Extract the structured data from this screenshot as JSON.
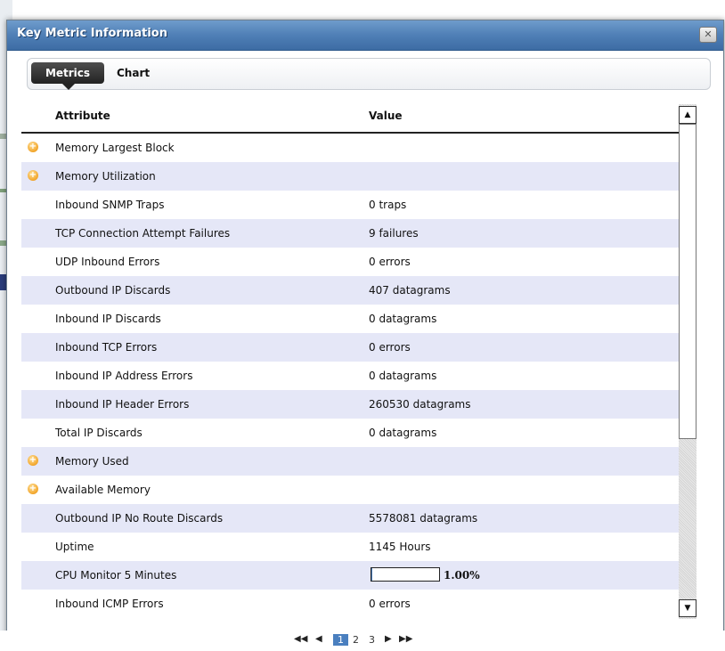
{
  "dialog": {
    "title": "Key Metric Information",
    "close_glyph": "✕"
  },
  "tabs": [
    {
      "label": "Metrics",
      "active": true
    },
    {
      "label": "Chart",
      "active": false
    }
  ],
  "table": {
    "columns": [
      "Attribute",
      "Value"
    ],
    "rows": [
      {
        "attribute": "Memory Largest Block",
        "value": "",
        "expandable": true
      },
      {
        "attribute": "Memory Utilization",
        "value": "",
        "expandable": true
      },
      {
        "attribute": "Inbound SNMP Traps",
        "value": "0 traps",
        "expandable": false
      },
      {
        "attribute": "TCP Connection Attempt Failures",
        "value": "9 failures",
        "expandable": false
      },
      {
        "attribute": "UDP Inbound Errors",
        "value": "0 errors",
        "expandable": false
      },
      {
        "attribute": "Outbound IP Discards",
        "value": "407 datagrams",
        "expandable": false
      },
      {
        "attribute": "Inbound IP Discards",
        "value": "0 datagrams",
        "expandable": false
      },
      {
        "attribute": "Inbound TCP Errors",
        "value": "0 errors",
        "expandable": false
      },
      {
        "attribute": "Inbound IP Address Errors",
        "value": "0 datagrams",
        "expandable": false
      },
      {
        "attribute": "Inbound IP Header Errors",
        "value": "260530 datagrams",
        "expandable": false
      },
      {
        "attribute": "Total IP Discards",
        "value": "0 datagrams",
        "expandable": false
      },
      {
        "attribute": "Memory Used",
        "value": "",
        "expandable": true
      },
      {
        "attribute": "Available Memory",
        "value": "",
        "expandable": true
      },
      {
        "attribute": "Outbound IP No Route Discards",
        "value": "5578081 datagrams",
        "expandable": false
      },
      {
        "attribute": "Uptime",
        "value": "1145 Hours",
        "expandable": false
      },
      {
        "attribute": "CPU Monitor 5 Minutes",
        "value": "1.00%",
        "expandable": false,
        "progress_fraction": 0.01
      },
      {
        "attribute": "Inbound ICMP Errors",
        "value": "0 errors",
        "expandable": false
      }
    ]
  },
  "pager": {
    "first_glyph": "◀◀",
    "prev_glyph": "◀",
    "pages": [
      "1",
      "2",
      "3"
    ],
    "current_page": "1",
    "next_glyph": "▶",
    "last_glyph": "▶▶"
  },
  "icons": {
    "expander": "expand-icon",
    "scroll_up": "▲",
    "scroll_down": "▼"
  },
  "colors": {
    "titlebar": "#4f7fb6",
    "row_alt": "#e5e7f7",
    "expander": "#f2a52a",
    "tab_active": "#222222"
  }
}
